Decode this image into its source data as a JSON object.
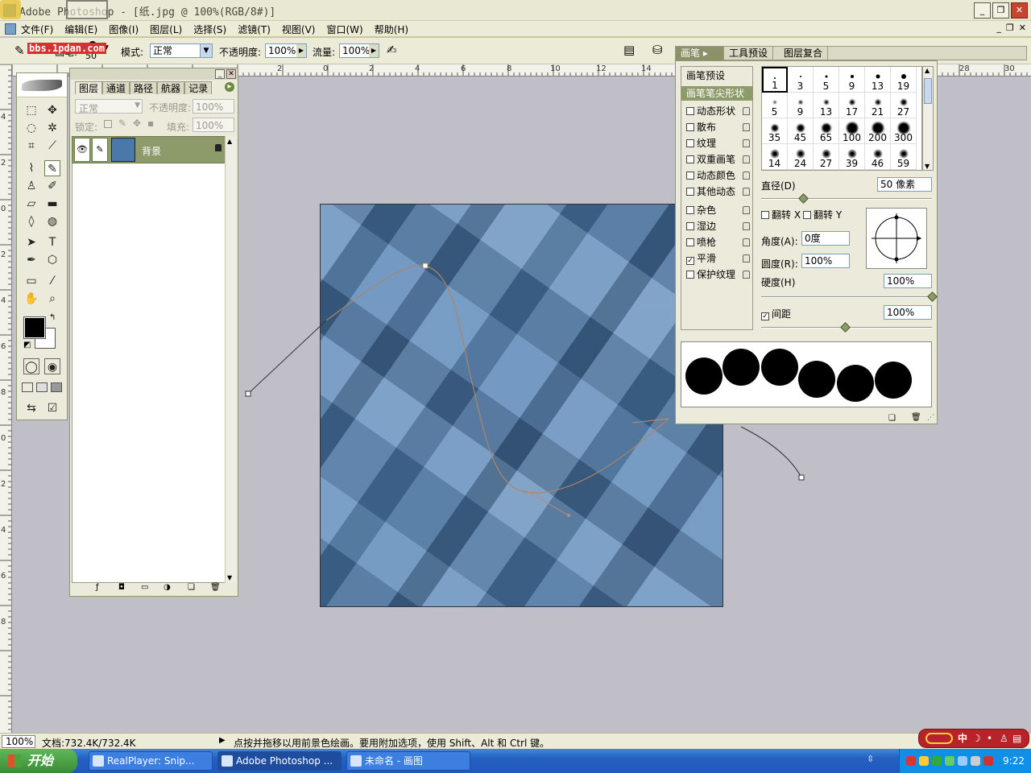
{
  "window": {
    "title": "Adobe Photoshop - [纸.jpg @ 100%(RGB/8#)]",
    "watermark": "bbs.1pdan.com"
  },
  "menu": {
    "items": [
      "文件(F)",
      "编辑(E)",
      "图像(I)",
      "图层(L)",
      "选择(S)",
      "滤镜(T)",
      "视图(V)",
      "窗口(W)",
      "帮助(H)"
    ]
  },
  "options": {
    "brush_label": "画笔:",
    "brush_size": "50",
    "mode_label": "模式:",
    "mode_value": "正常",
    "opacity_label": "不透明度:",
    "opacity_value": "100%",
    "flow_label": "流量:",
    "flow_value": "100%"
  },
  "palette_well": {
    "tabs": [
      "画笔",
      "工具预设",
      "图层复合"
    ]
  },
  "rulers": {
    "top": [
      "2",
      "0",
      "2",
      "4",
      "6",
      "8",
      "10",
      "12",
      "14",
      "28",
      "30"
    ],
    "left": [
      "4",
      "2",
      "0",
      "2",
      "4",
      "6",
      "8",
      "0",
      "2",
      "4",
      "6",
      "8"
    ]
  },
  "layers": {
    "tabs": [
      "图层",
      "通道",
      "路径",
      "航器",
      "记录"
    ],
    "blend_mode": "正常",
    "opacity_label": "不透明度:",
    "opacity_value": "100%",
    "lock_label": "锁定:",
    "fill_label": "填充:",
    "fill_value": "100%",
    "layer_name": "背景"
  },
  "brushes": {
    "presets_label": "画笔预设",
    "tip_shape_label": "画笔笔尖形状",
    "options": [
      {
        "label": "动态形状",
        "checked": false
      },
      {
        "label": "散布",
        "checked": false
      },
      {
        "label": "纹理",
        "checked": false
      },
      {
        "label": "双重画笔",
        "checked": false
      },
      {
        "label": "动态颜色",
        "checked": false
      },
      {
        "label": "其他动态",
        "checked": false
      },
      {
        "label": "杂色",
        "checked": false
      },
      {
        "label": "湿边",
        "checked": false
      },
      {
        "label": "喷枪",
        "checked": false
      },
      {
        "label": "平滑",
        "checked": true
      },
      {
        "label": "保护纹理",
        "checked": false
      }
    ],
    "presets": [
      "1",
      "3",
      "5",
      "9",
      "13",
      "19",
      "5",
      "9",
      "13",
      "17",
      "21",
      "27",
      "35",
      "45",
      "65",
      "100",
      "200",
      "300",
      "14",
      "24",
      "27",
      "39",
      "46",
      "59"
    ],
    "diameter_label": "直径(D)",
    "diameter_value": "50 像素",
    "flip_x_label": "翻转 X",
    "flip_y_label": "翻转 Y",
    "angle_label": "角度(A):",
    "angle_value": "0度",
    "roundness_label": "圆度(R):",
    "roundness_value": "100%",
    "hardness_label": "硬度(H)",
    "hardness_value": "100%",
    "spacing_label": "间距",
    "spacing_checked": true,
    "spacing_value": "100%"
  },
  "status": {
    "zoom": "100%",
    "doc_size": "文档:732.4K/732.4K",
    "hint": "点按并拖移以用前景色绘画。要用附加选项，使用 Shift、Alt 和 Ctrl 键。"
  },
  "taskbar": {
    "start": "开始",
    "tasks": [
      "RealPlayer: Snip...",
      "Adobe Photoshop ...",
      "未命名 - 画图"
    ],
    "clock": "9:22",
    "qq_label": "中"
  },
  "colors": {
    "foreground": "#000000",
    "background": "#ffffff",
    "canvas_blue": "#4f7fb3"
  }
}
